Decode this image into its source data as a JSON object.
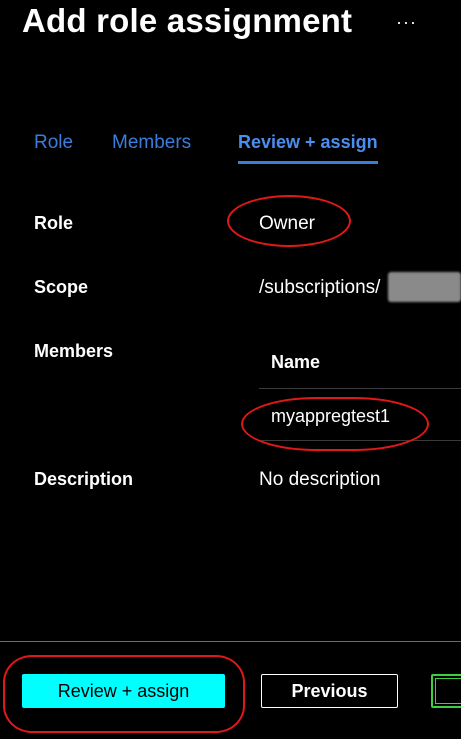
{
  "header": {
    "title": "Add role assignment",
    "more_label": "···"
  },
  "tabs": [
    {
      "label": "Role",
      "active": false
    },
    {
      "label": "Members",
      "active": false
    },
    {
      "label": "Review + assign",
      "active": true
    }
  ],
  "details": {
    "role_label": "Role",
    "role_value": "Owner",
    "scope_label": "Scope",
    "scope_value": "/subscriptions/",
    "members_label": "Members",
    "members_table": {
      "column_name": "Name",
      "rows": [
        "myappregtest1"
      ]
    },
    "description_label": "Description",
    "description_value": "No description"
  },
  "footer": {
    "review_assign_label": "Review + assign",
    "previous_label": "Previous"
  },
  "colors": {
    "background": "#000000",
    "tab_link": "#3b7ddd",
    "primary_button": "#00ffff",
    "annotation_red": "#e01818",
    "green_button_border": "#3ad13a"
  }
}
